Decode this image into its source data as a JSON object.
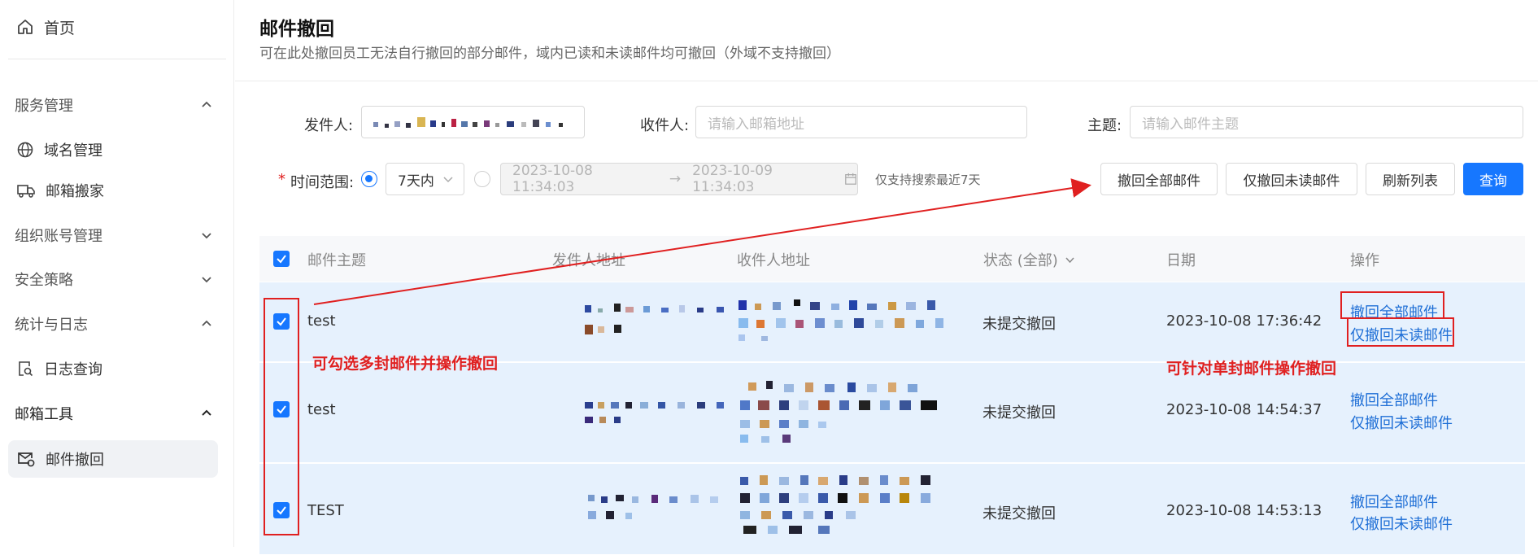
{
  "sidebar": {
    "home": "首页",
    "groups": {
      "service": "服务管理",
      "domain": "域名管理",
      "migration": "邮箱搬家",
      "org": "组织账号管理",
      "security": "安全策略",
      "stats": "统计与日志",
      "log_query": "日志查询",
      "tools": "邮箱工具",
      "recall": "邮件撤回"
    }
  },
  "page": {
    "title": "邮件撤回",
    "description": "可在此处撤回员工无法自行撤回的部分邮件，域内已读和未读邮件均可撤回（外域不支持撤回）"
  },
  "filters": {
    "sender_label": "发件人:",
    "recipient_label": "收件人:",
    "recipient_placeholder": "请输入邮箱地址",
    "subject_label": "主题:",
    "subject_placeholder": "请输入邮件主题",
    "time_required_mark": "*",
    "time_label": "时间范围:",
    "time_preset": "7天内",
    "date_start": "2023-10-08 11:34:03",
    "date_arrow": "→",
    "date_end": "2023-10-09 11:34:03",
    "date_hint": "仅支持搜索最近7天"
  },
  "actions": {
    "recall_all": "撤回全部邮件",
    "recall_unread": "仅撤回未读邮件",
    "refresh": "刷新列表",
    "query": "查询"
  },
  "table": {
    "columns": {
      "subject": "邮件主题",
      "sender": "发件人地址",
      "recipient": "收件人地址",
      "status": "状态 (全部)",
      "date": "日期",
      "ops": "操作"
    },
    "rows": [
      {
        "subject": "test",
        "status": "未提交撤回",
        "date": "2023-10-08 17:36:42",
        "op_all": "撤回全部邮件",
        "op_unread": "仅撤回未读邮件"
      },
      {
        "subject": "test",
        "status": "未提交撤回",
        "date": "2023-10-08 14:54:37",
        "op_all": "撤回全部邮件",
        "op_unread": "仅撤回未读邮件"
      },
      {
        "subject": "TEST",
        "status": "未提交撤回",
        "date": "2023-10-08 14:53:13",
        "op_all": "撤回全部邮件",
        "op_unread": "仅撤回未读邮件"
      }
    ]
  },
  "annotations": {
    "multi_select": "可勾选多封邮件并操作撤回",
    "single_row": "可针对单封邮件操作撤回"
  },
  "colors": {
    "primary": "#1677ff",
    "row_selected": "#e6f1fd",
    "annotation": "#e02020"
  }
}
